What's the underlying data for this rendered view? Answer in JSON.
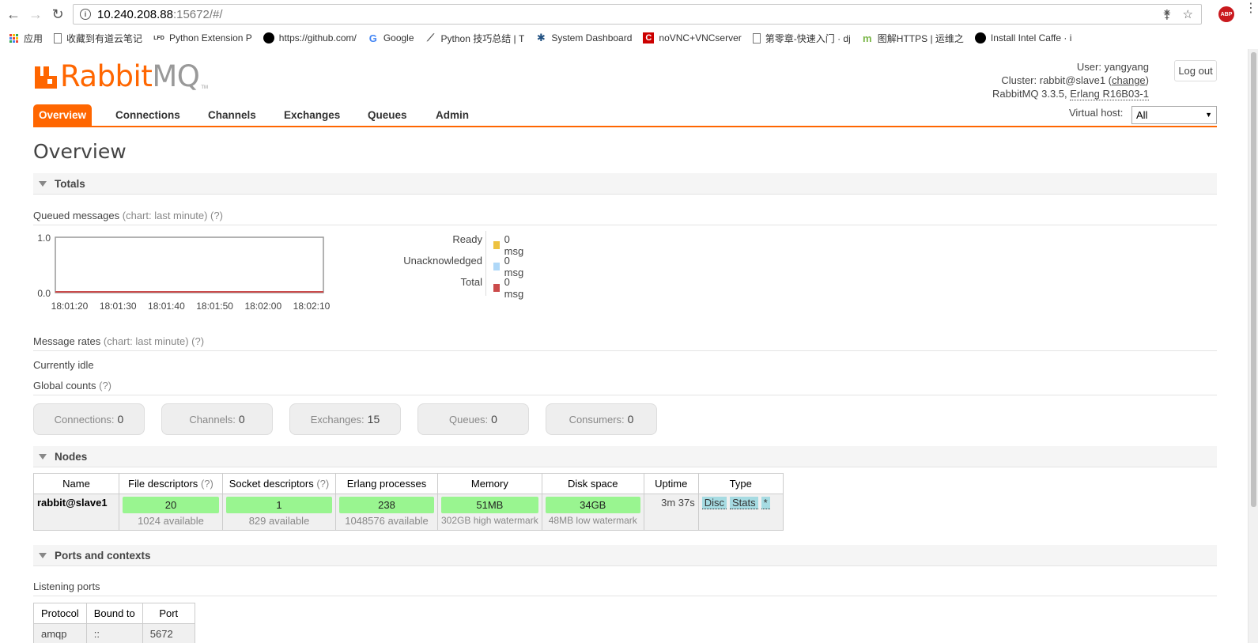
{
  "browser": {
    "url_host": "10.240.208.88",
    "url_rest": ":15672/#/",
    "abp_label": "ABP",
    "bookmarks": [
      {
        "label": "应用",
        "icon": "apps-icon"
      },
      {
        "label": "收藏到有道云笔记",
        "icon": "page-icon"
      },
      {
        "label": "Python Extension P",
        "icon": "lfd-icon",
        "icon_text": "LFD"
      },
      {
        "label": "https://github.com/",
        "icon": "github-icon"
      },
      {
        "label": "Google",
        "icon": "google-icon",
        "icon_text": "G"
      },
      {
        "label": "Python 技巧总结 | T",
        "icon": "feather-icon"
      },
      {
        "label": "System Dashboard",
        "icon": "jira-icon"
      },
      {
        "label": "noVNC+VNCserver",
        "icon": "c-icon",
        "icon_text": "C"
      },
      {
        "label": "第零章-快速入门 · dj",
        "icon": "book-icon"
      },
      {
        "label": "图解HTTPS | 运维之",
        "icon": "m-icon",
        "icon_text": "m"
      },
      {
        "label": "Install Intel Caffe · i",
        "icon": "github-icon"
      }
    ]
  },
  "header": {
    "logo_rabbit": "Rabbit",
    "logo_mq": "MQ",
    "logo_tm": "TM",
    "user_label": "User:",
    "user_name": "yangyang",
    "cluster_label": "Cluster:",
    "cluster_name": "rabbit@slave1",
    "change_link": "change",
    "version": "RabbitMQ 3.3.5,",
    "erlang": "Erlang R16B03-1",
    "logout": "Log out",
    "vhost_label": "Virtual host:",
    "vhost_value": "All"
  },
  "tabs": [
    {
      "label": "Overview",
      "active": true
    },
    {
      "label": "Connections"
    },
    {
      "label": "Channels"
    },
    {
      "label": "Exchanges"
    },
    {
      "label": "Queues"
    },
    {
      "label": "Admin"
    }
  ],
  "page_title": "Overview",
  "totals": {
    "title": "Totals",
    "queued_label": "Queued messages",
    "queued_hint": "(chart: last minute) (?)",
    "legend": [
      {
        "label": "Ready",
        "value": "0 msg",
        "color": "#edc240"
      },
      {
        "label": "Unacknowledged",
        "value": "0 msg",
        "color": "#afd8f8"
      },
      {
        "label": "Total",
        "value": "0 msg",
        "color": "#cb4b4b"
      }
    ],
    "rates_label": "Message rates",
    "rates_hint": "(chart: last minute) (?)",
    "idle": "Currently idle",
    "global_label": "Global counts",
    "global_hint": "(?)",
    "counts": [
      {
        "label": "Connections:",
        "value": "0"
      },
      {
        "label": "Channels:",
        "value": "0"
      },
      {
        "label": "Exchanges:",
        "value": "15"
      },
      {
        "label": "Queues:",
        "value": "0"
      },
      {
        "label": "Consumers:",
        "value": "0"
      }
    ]
  },
  "chart_data": {
    "type": "line",
    "x": [
      "18:01:20",
      "18:01:30",
      "18:01:40",
      "18:01:50",
      "18:02:00",
      "18:02:10"
    ],
    "series": [
      {
        "name": "Ready",
        "values": [
          0,
          0,
          0,
          0,
          0,
          0
        ]
      },
      {
        "name": "Unacknowledged",
        "values": [
          0,
          0,
          0,
          0,
          0,
          0
        ]
      },
      {
        "name": "Total",
        "values": [
          0,
          0,
          0,
          0,
          0,
          0
        ]
      }
    ],
    "y_ticks": [
      "1.0",
      "0.0"
    ],
    "ylim": [
      0,
      1
    ],
    "title": "",
    "xlabel": "",
    "ylabel": ""
  },
  "nodes": {
    "title": "Nodes",
    "headers": {
      "name": "Name",
      "fd": "File descriptors",
      "sd": "Socket descriptors",
      "erl": "Erlang processes",
      "mem": "Memory",
      "disk": "Disk space",
      "uptime": "Uptime",
      "type": "Type"
    },
    "help": "(?)",
    "row": {
      "name": "rabbit@slave1",
      "fd": "20",
      "fd_sub": "1024 available",
      "sd": "1",
      "sd_sub": "829 available",
      "erl": "238",
      "erl_sub": "1048576 available",
      "mem": "51MB",
      "mem_sub": "302GB high watermark",
      "disk": "34GB",
      "disk_sub": "48MB low watermark",
      "uptime": "3m 37s",
      "type_disc": "Disc",
      "type_stats": "Stats",
      "type_star": "*"
    }
  },
  "ports": {
    "title": "Ports and contexts",
    "listening": "Listening ports",
    "headers": {
      "protocol": "Protocol",
      "bound": "Bound to",
      "port": "Port"
    },
    "row": {
      "protocol": "amqp",
      "bound": "::",
      "port": "5672"
    }
  }
}
